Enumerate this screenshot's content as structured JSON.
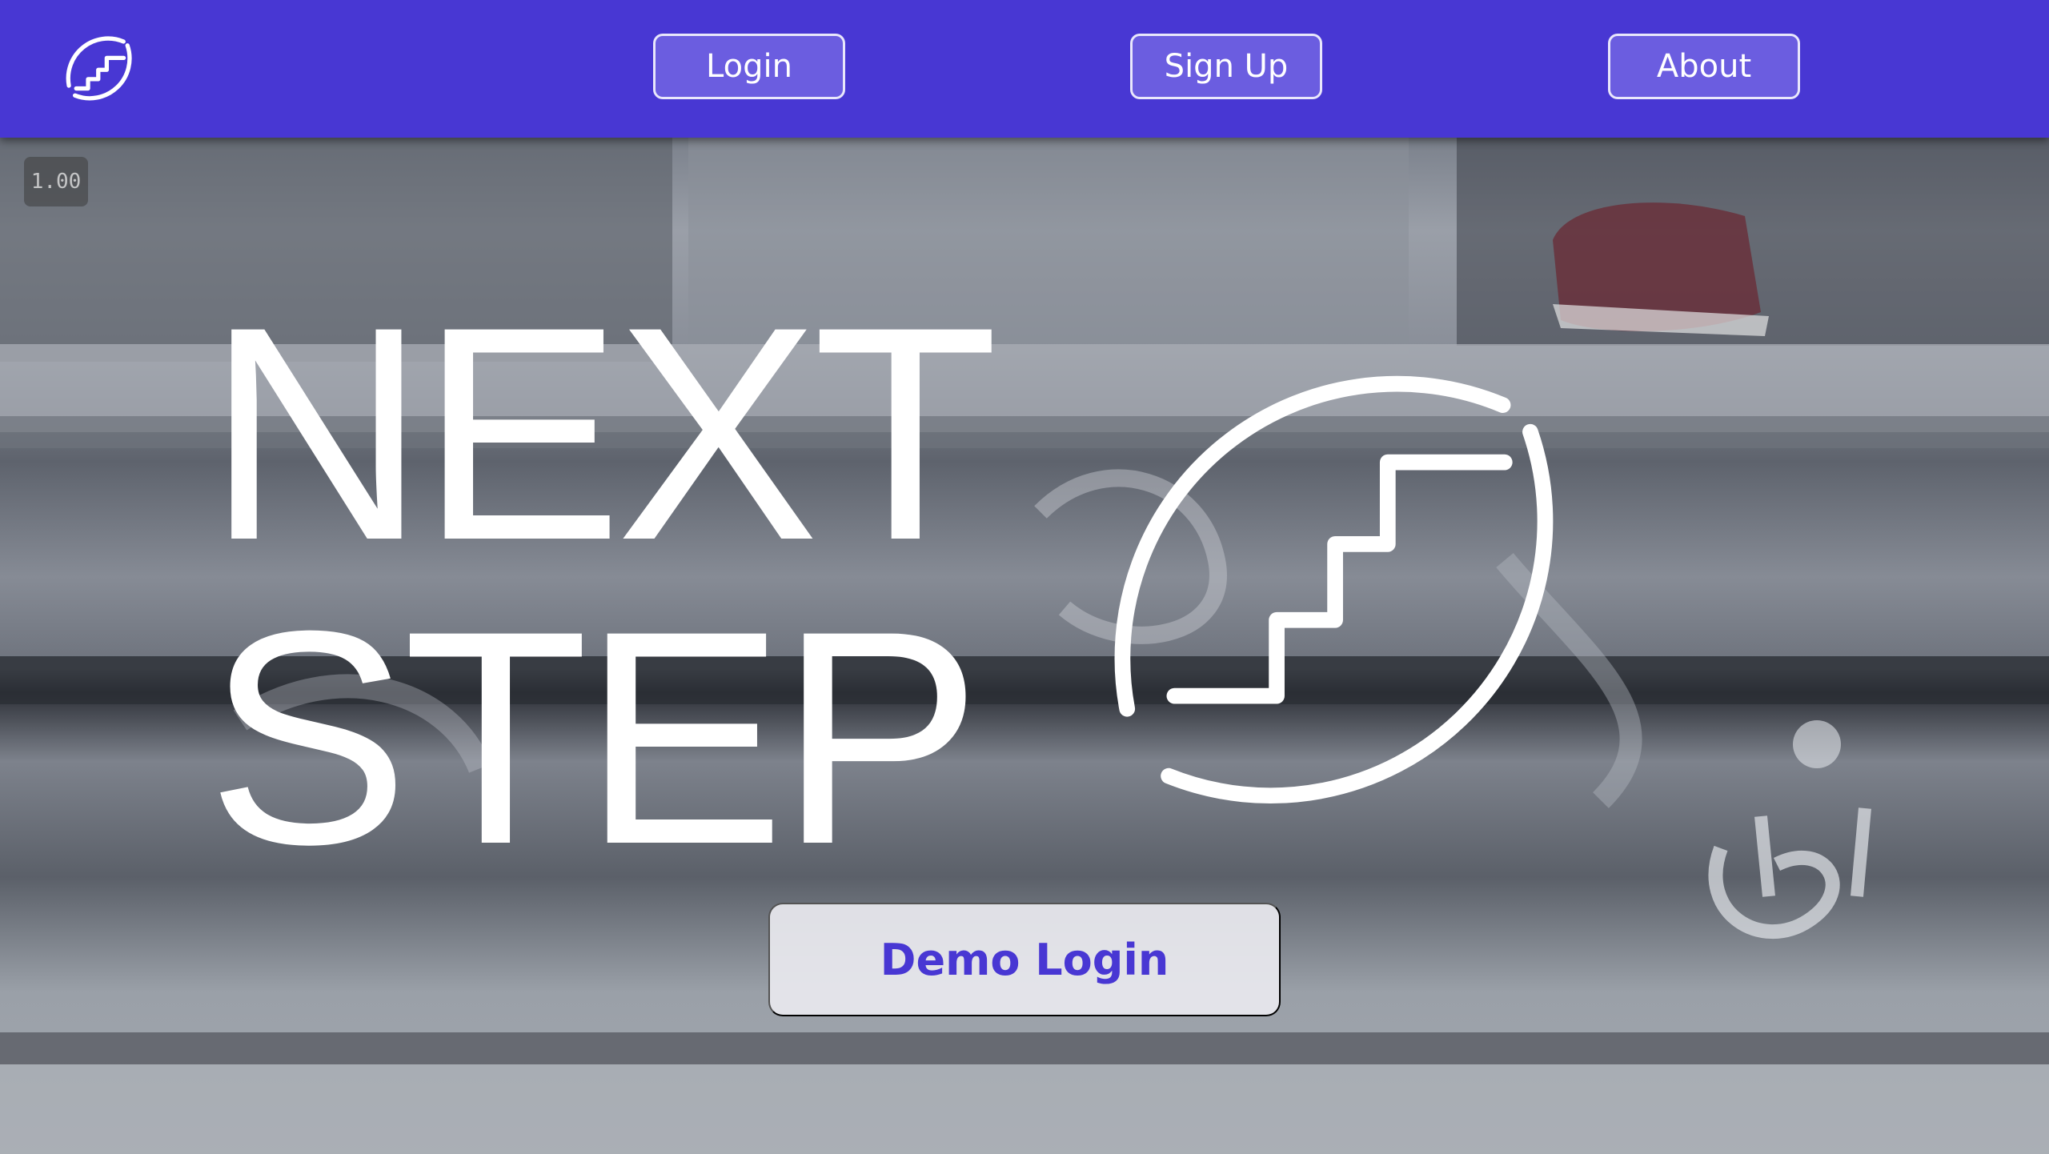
{
  "nav": {
    "logo_icon": "stairs-circle-icon",
    "login_label": "Login",
    "signup_label": "Sign Up",
    "about_label": "About"
  },
  "player": {
    "speed": "1.00"
  },
  "hero": {
    "title_line1": "NEXT",
    "title_line2": "STEP",
    "logo_icon": "stairs-circle-icon",
    "demo_label": "Demo Login"
  },
  "colors": {
    "brand": "#4837d3",
    "button_fill": "#6b5de0",
    "text_light": "#ffffff"
  }
}
